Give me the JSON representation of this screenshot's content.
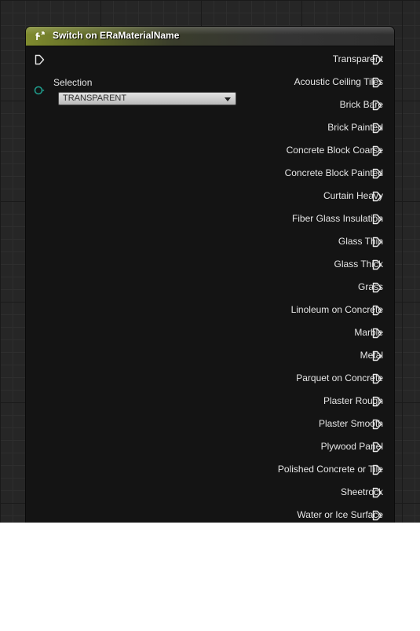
{
  "node": {
    "title": "Switch on ERaMaterialName",
    "icon": "switch-function-icon",
    "header_accent_color": "#7f8b2e",
    "exec_in_icon": "exec-input-pin-icon",
    "selection": {
      "label": "Selection",
      "pin_icon": "data-input-pin-icon",
      "pin_color": "#1f9a8a",
      "value": "TRANSPARENT"
    },
    "outputs": [
      "Transparent",
      "Acoustic Ceiling Tiles",
      "Brick Bare",
      "Brick Painted",
      "Concrete Block Coarse",
      "Concrete Block Painted",
      "Curtain Heavy",
      "Fiber Glass Insulation",
      "Glass Thin",
      "Glass Thick",
      "Grass",
      "Linoleum on Concrete",
      "Marble",
      "Metal",
      "Parquet on Concrete",
      "Plaster Rough",
      "Plaster Smooth",
      "Plywood Panel",
      "Polished Concrete or Tile",
      "Sheetrock",
      "Water or Ice Surface"
    ]
  }
}
